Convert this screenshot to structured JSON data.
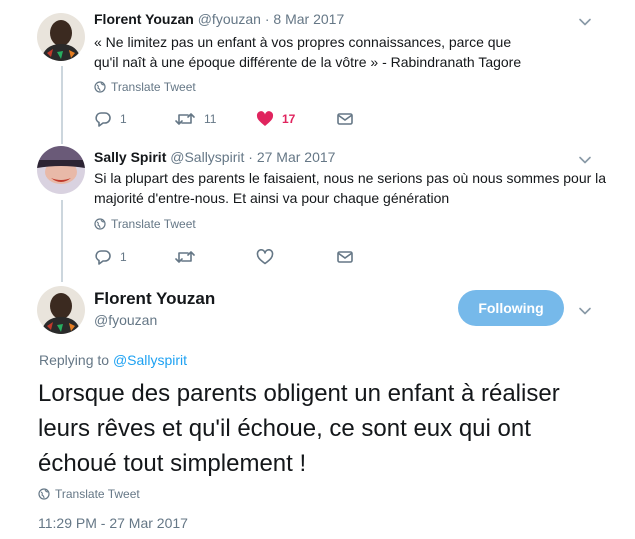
{
  "colors": {
    "accent": "#1da1f2",
    "follow_button": "#76b9ea",
    "like_red": "#e0245e",
    "muted": "#657786",
    "thread_line": "#ccd6dd"
  },
  "tweet1": {
    "name": "Florent Youzan",
    "handle": "@fyouzan",
    "separator": "·",
    "date": "8 Mar 2017",
    "text": "« Ne limitez pas un enfant à vos propres connaissances, parce que qu'il naît à une époque différente de la vôtre » - Rabindranath Tagore",
    "translate_label": "Translate Tweet",
    "replies": "1",
    "retweets": "11",
    "likes": "17",
    "icons": [
      "reply-icon",
      "retweet-icon",
      "heart-filled-icon",
      "message-icon",
      "chevron-down-icon",
      "globe-icon"
    ]
  },
  "tweet2": {
    "name": "Sally Spirit",
    "handle": "@Sallyspirit",
    "separator": "·",
    "date": "27 Mar 2017",
    "text": "Si la plupart des parents le faisaient, nous ne serions pas où nous sommes pour la majorité d'entre-nous. Et ainsi va pour chaque génération",
    "translate_label": "Translate Tweet",
    "replies": "1",
    "icons": [
      "reply-icon",
      "retweet-icon",
      "heart-icon",
      "message-icon",
      "chevron-down-icon",
      "globe-icon"
    ]
  },
  "main_tweet": {
    "name": "Florent Youzan",
    "handle": "@fyouzan",
    "follow_label": "Following",
    "replying_prefix": "Replying to",
    "replying_to": "@Sallyspirit",
    "text": "Lorsque des parents obligent un enfant à réaliser leurs rêves et qu'il échoue, ce sont eux qui ont échoué tout simplement !",
    "translate_label": "Translate Tweet",
    "timestamp": "11:29 PM - 27 Mar 2017"
  }
}
